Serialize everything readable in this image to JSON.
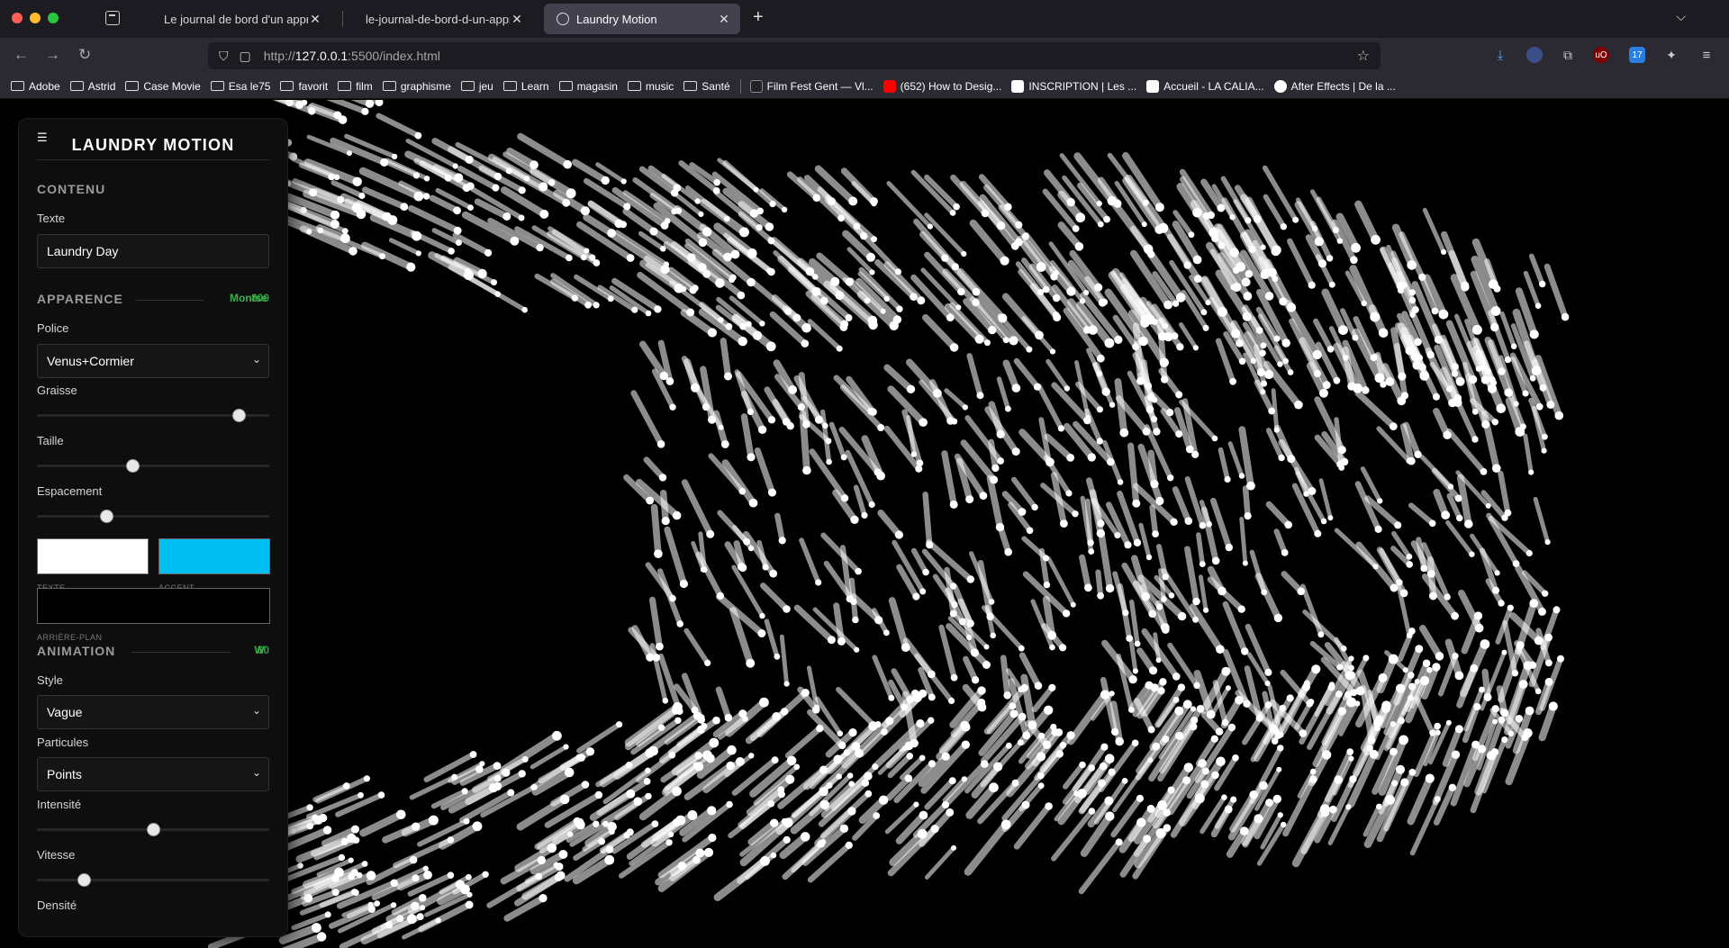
{
  "browser": {
    "tabs": [
      {
        "title": "Le journal de bord d'un apprenti"
      },
      {
        "title": "le-journal-de-bord-d-un-apprenti"
      },
      {
        "title": "Laundry Motion"
      }
    ],
    "url_base": "http://",
    "url_host": "127.0.0.1",
    "url_rest": ":5500/index.html",
    "bookmarks": [
      {
        "label": "Adobe",
        "icon": "folder-icon"
      },
      {
        "label": "Astrid",
        "icon": "folder-icon"
      },
      {
        "label": "Case Movie",
        "icon": "folder-icon"
      },
      {
        "label": "Esa le75",
        "icon": "folder-icon"
      },
      {
        "label": "favorit",
        "icon": "folder-icon"
      },
      {
        "label": "film",
        "icon": "folder-icon"
      },
      {
        "label": "graphisme",
        "icon": "folder-icon"
      },
      {
        "label": "jeu",
        "icon": "folder-icon"
      },
      {
        "label": "Learn",
        "icon": "folder-icon"
      },
      {
        "label": "magasin",
        "icon": "folder-icon"
      },
      {
        "label": "music",
        "icon": "folder-icon"
      },
      {
        "label": "Santé",
        "icon": "folder-icon"
      }
    ],
    "bookmark_links": [
      {
        "label": "Film Fest Gent — Vl...",
        "color": "#222222"
      },
      {
        "label": "(652) How to Desig...",
        "color": "#ff0000"
      },
      {
        "label": "INSCRIPTION | Les ...",
        "color": "#ffffff"
      },
      {
        "label": "Accueil - LA CALIA...",
        "color": "#ffffff"
      },
      {
        "label": "After Effects | De la ...",
        "color": "#ffffff"
      }
    ]
  },
  "panel": {
    "title": "LAUNDRY MOTION",
    "contenu": {
      "title": "CONTENU",
      "texte_label": "Texte",
      "texte_value": "Laundry Day"
    },
    "apparence": {
      "title": "APPARENCE",
      "overlay_value": "Montse",
      "overlay_value2": "800",
      "police_label": "Police",
      "police_value": "Venus+Cormier",
      "graisse_label": "Graisse",
      "graisse_level": 0.87,
      "taille_label": "Taille",
      "taille_level": 0.41,
      "espacement_label": "Espacement",
      "espacement_level": 0.3,
      "texte_color": "#ffffff",
      "accent_color": "#00bff3",
      "bg_color": "#000000",
      "texte_swatch_label": "TEXTE",
      "accent_swatch_label": "ACCENT",
      "bg_swatch_label": "ARRIÈRE-PLAN"
    },
    "animation": {
      "title": "ANIMATION",
      "overlay_value": "W",
      "overlay_value2": "60",
      "style_label": "Style",
      "style_value": "Vague",
      "particules_label": "Particules",
      "particules_value": "Points",
      "intensite_label": "Intensité",
      "intensite_level": 0.5,
      "vitesse_label": "Vitesse",
      "vitesse_level": 0.2,
      "densite_label": "Densité"
    }
  }
}
